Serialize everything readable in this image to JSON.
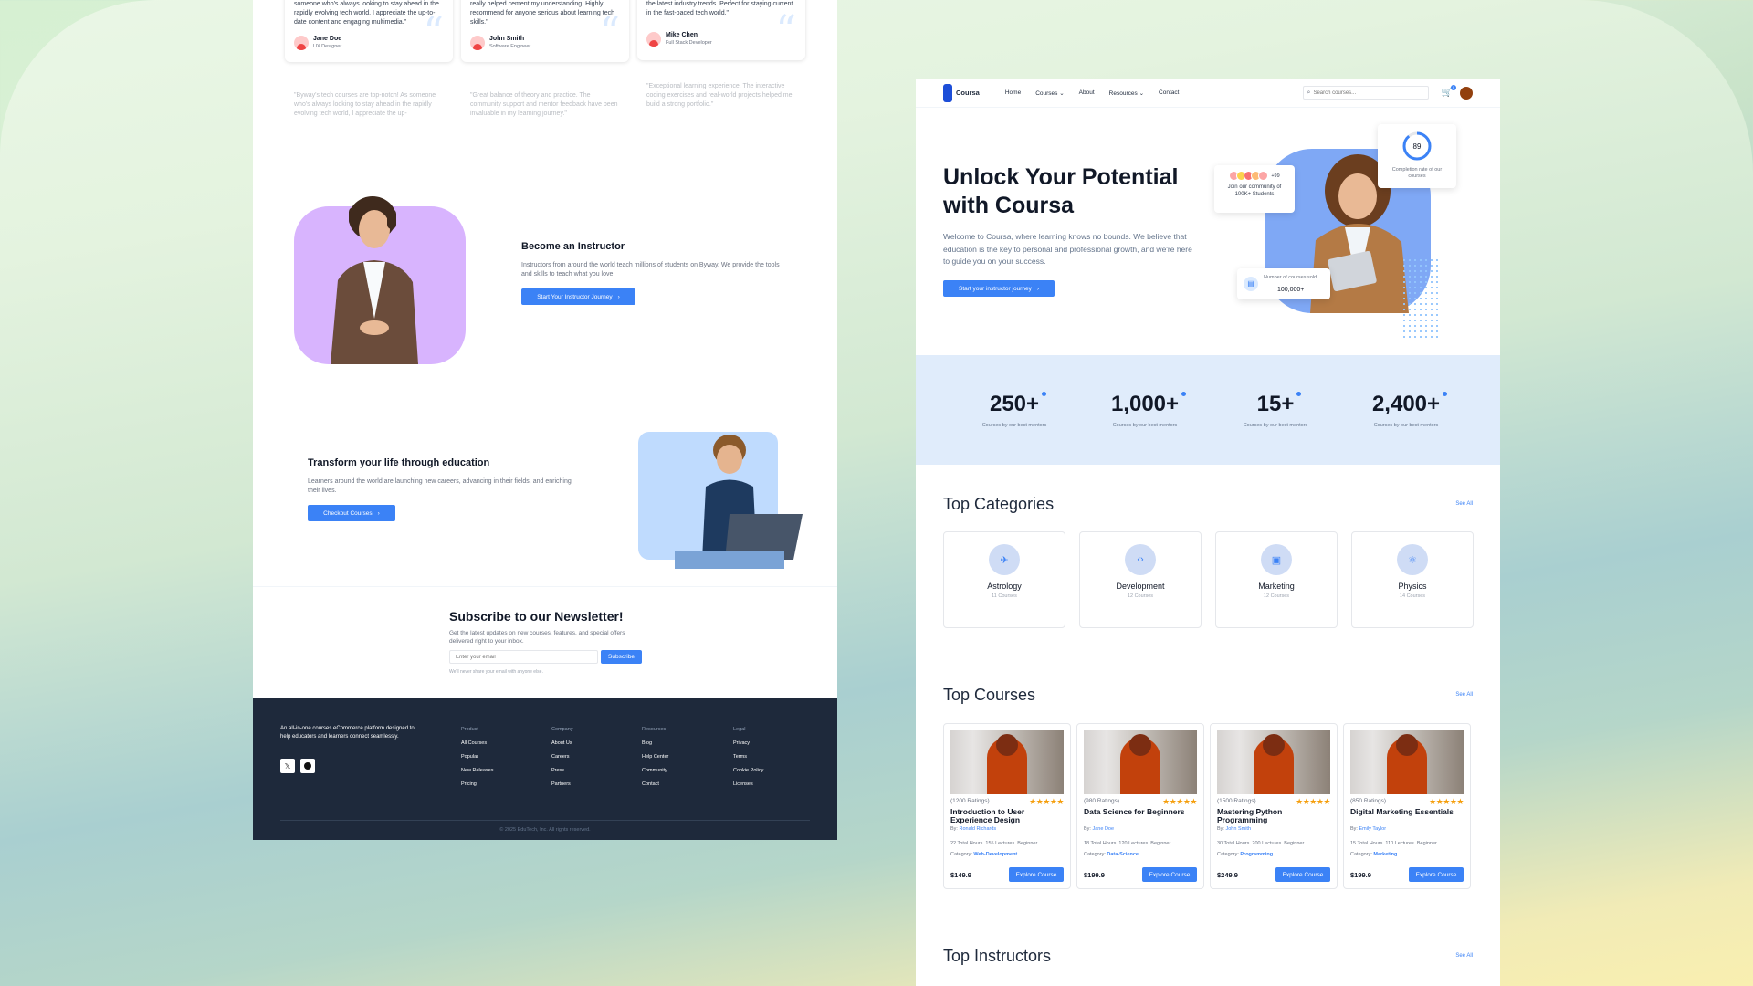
{
  "left": {
    "testimonials": [
      {
        "text": "someone who's always looking to stay ahead in the rapidly evolving tech world. I appreciate the up-to-date content and engaging multimedia.\"",
        "name": "Jane Doe",
        "role": "UX Designer"
      },
      {
        "text": "really helped cement my understanding. Highly recommend for anyone serious about learning tech skills.\"",
        "name": "John Smith",
        "role": "Software Engineer"
      },
      {
        "text": "the latest industry trends. Perfect for staying current in the fast-paced tech world.\"",
        "name": "Mike Chen",
        "role": "Full Stack Developer"
      }
    ],
    "testimonials_faded": [
      "\"Byway's tech courses are top-notch! As someone who's always looking to stay ahead in the rapidly evolving tech world, I appreciate the up-",
      "\"Great balance of theory and practice. The community support and mentor feedback have been invaluable in my learning journey.\"",
      "\"Exceptional learning experience. The interactive coding exercises and real-world projects helped me build a strong portfolio.\""
    ],
    "instructor": {
      "title": "Become an Instructor",
      "desc": "Instructors from around the world teach millions of students on Byway. We provide the tools and skills to teach what you love.",
      "button": "Start Your Instructor Journey"
    },
    "transform": {
      "title": "Transform your life through education",
      "desc": "Learners around the world are launching new careers, advancing in their fields, and enriching their lives.",
      "button": "Checkout Courses"
    },
    "newsletter": {
      "title": "Subscribe to our Newsletter!",
      "desc": "Get the latest updates on new courses, features, and special offers delivered right to your inbox.",
      "placeholder": "Enter your email",
      "button": "Subscribe",
      "note": "We'll never share your email with anyone else."
    },
    "footer": {
      "about": "An all-in-one courses eCommerce platform designed to help educators and learners connect seamlessly.",
      "columns": [
        {
          "heading": "Product",
          "links": [
            "All Courses",
            "Popular",
            "New Releases",
            "Pricing"
          ]
        },
        {
          "heading": "Company",
          "links": [
            "About Us",
            "Careers",
            "Press",
            "Partners"
          ]
        },
        {
          "heading": "Resources",
          "links": [
            "Blog",
            "Help Center",
            "Community",
            "Contact"
          ]
        },
        {
          "heading": "Legal",
          "links": [
            "Privacy",
            "Terms",
            "Cookie Policy",
            "Licenses"
          ]
        }
      ],
      "copyright": "© 2025 EduTech, Inc. All rights reserved."
    }
  },
  "right": {
    "nav": {
      "brand": "Coursa",
      "links": [
        "Home",
        "Courses",
        "About",
        "Resources",
        "Contact"
      ],
      "search_placeholder": "Search courses...",
      "cart_count": "0"
    },
    "hero": {
      "title": "Unlock Your Potential with Coursa",
      "desc": "Welcome to Coursa, where learning knows no bounds. We believe that education is the key to personal and professional growth, and we're here to guide you on your success.",
      "button": "Start your instructor journey",
      "community_badge": "+99",
      "community_text": "Join our community of 100K+ Students",
      "completion_value": "89",
      "completion_text": "Completion rate of our courses",
      "sold_label": "Number of courses sold",
      "sold_value": "100,000+"
    },
    "stats": [
      {
        "value": "250+",
        "caption": "Courses by our best mentors"
      },
      {
        "value": "1,000+",
        "caption": "Courses by our best mentors"
      },
      {
        "value": "15+",
        "caption": "Courses by our best mentors"
      },
      {
        "value": "2,400+",
        "caption": "Courses by our best mentors"
      }
    ],
    "categories_title": "Top Categories",
    "see_all": "See All",
    "categories": [
      {
        "name": "Astrology",
        "count": "11 Courses",
        "icon": "telescope-icon"
      },
      {
        "name": "Development",
        "count": "12 Courses",
        "icon": "code-icon"
      },
      {
        "name": "Marketing",
        "count": "12 Courses",
        "icon": "briefcase-icon"
      },
      {
        "name": "Physics",
        "count": "14 Courses",
        "icon": "atom-icon"
      }
    ],
    "courses_title": "Top Courses",
    "courses": [
      {
        "ratings": "(1200 Ratings)",
        "title": "Introduction to User Experience Design",
        "by": "By:",
        "author": "Ronald Richards",
        "meta": "22 Total Hours. 155 Lectures. Beginner",
        "cat_label": "Category:",
        "category": "Web-Development",
        "price": "$149.9",
        "button": "Explore Course"
      },
      {
        "ratings": "(980 Ratings)",
        "title": "Data Science for Beginners",
        "by": "By:",
        "author": "Jane Doe",
        "meta": "18 Total Hours. 120 Lectures. Beginner",
        "cat_label": "Category:",
        "category": "Data-Science",
        "price": "$199.9",
        "button": "Explore Course"
      },
      {
        "ratings": "(1500 Ratings)",
        "title": "Mastering Python Programming",
        "by": "By:",
        "author": "John Smith",
        "meta": "30 Total Hours. 200 Lectures. Beginner",
        "cat_label": "Category:",
        "category": "Programming",
        "price": "$249.9",
        "button": "Explore Course"
      },
      {
        "ratings": "(850 Ratings)",
        "title": "Digital Marketing Essentials",
        "by": "By:",
        "author": "Emily Taylor",
        "meta": "15 Total Hours. 110 Lectures. Beginner",
        "cat_label": "Category:",
        "category": "Marketing",
        "price": "$199.9",
        "button": "Explore Course"
      }
    ],
    "instructors_title": "Top Instructors",
    "rating_stars": "★★★★★"
  },
  "colors": {
    "accent": "#3b82f6",
    "footer_bg": "#1e293b",
    "stats_bg": "#e0ecfb"
  }
}
